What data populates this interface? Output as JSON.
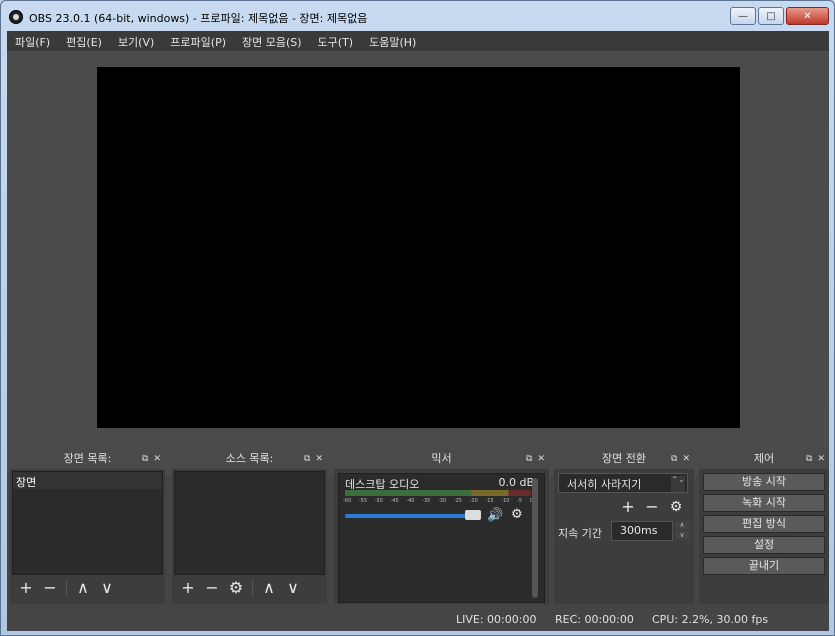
{
  "window": {
    "title": "OBS 23.0.1 (64-bit, windows) - 프로파일: 제목없음 - 장면: 제목없음",
    "minimize": "—",
    "maximize": "□",
    "close": "✕"
  },
  "menu": [
    "파일(F)",
    "편집(E)",
    "보기(V)",
    "프로파일(P)",
    "장면 모음(S)",
    "도구(T)",
    "도움말(H)"
  ],
  "docks": {
    "scenes": {
      "title": "장면 목록:",
      "items": [
        "장면"
      ]
    },
    "sources": {
      "title": "소스 목록:"
    },
    "mixer": {
      "title": "믹서",
      "track_name": "데스크탑 오디오",
      "db_value": "0.0 dB",
      "meter_ticks": [
        "-60",
        "-55",
        "-50",
        "-45",
        "-40",
        "-35",
        "-30",
        "-25",
        "-20",
        "-15",
        "-10",
        "-5",
        "0"
      ]
    },
    "transitions": {
      "title": "장면 전환",
      "selected": "서서히 사라지기",
      "duration_label": "지속 기간",
      "duration_value": "300ms"
    },
    "controls": {
      "title": "제어",
      "buttons": [
        "방송 시작",
        "녹화 시작",
        "편집 방식",
        "설정",
        "끝내기"
      ]
    }
  },
  "dock_controls": {
    "float": "⧉",
    "close": "✕"
  },
  "status": {
    "live": "LIVE: 00:00:00",
    "rec": "REC: 00:00:00",
    "cpu": "CPU: 2.2%, 30.00 fps"
  },
  "icons": {
    "add": "+",
    "remove": "−",
    "up": "∧",
    "down": "∨",
    "gear": "⚙",
    "volume": "🔊",
    "combo_arrow": "⌃⌄"
  }
}
